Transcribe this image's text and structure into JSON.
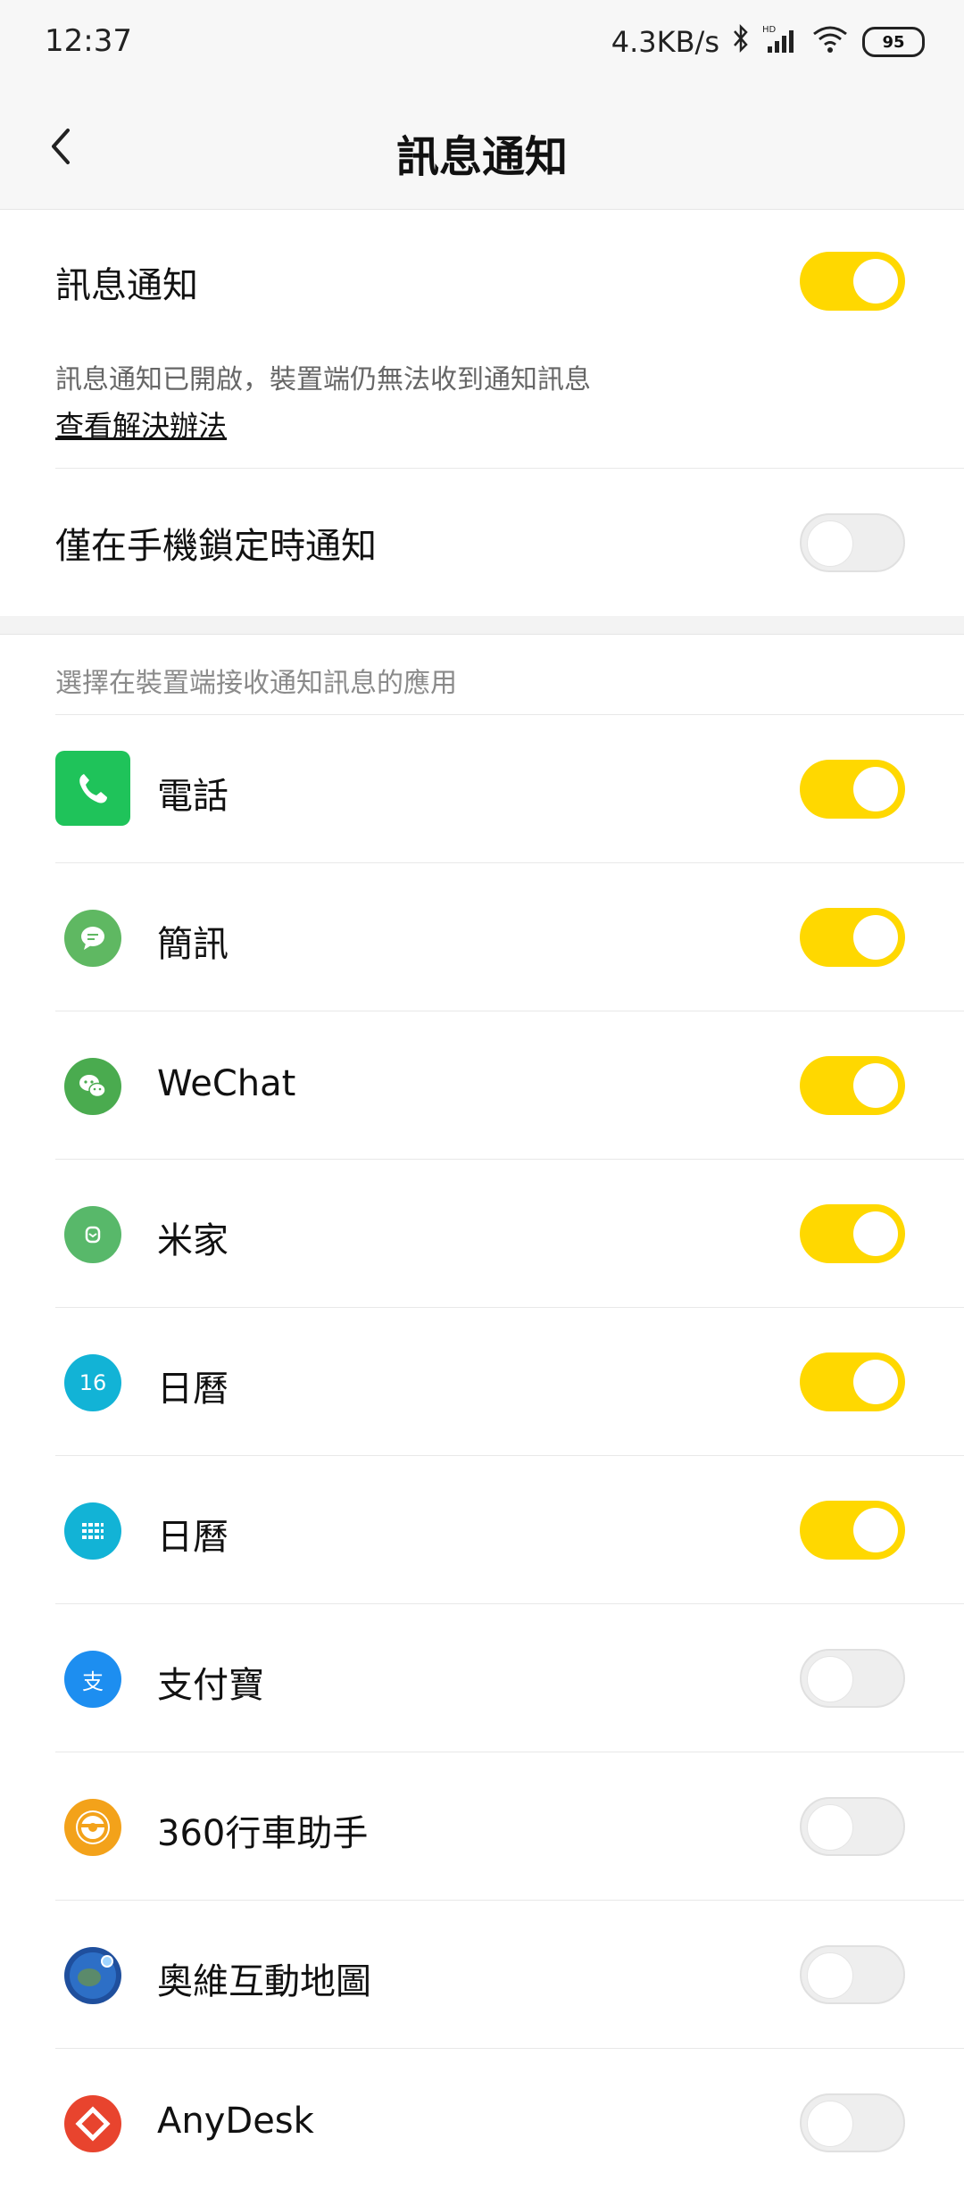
{
  "status_bar": {
    "time": "12:37",
    "net_speed": "4.3KB/s",
    "battery": "95",
    "icons": [
      "bluetooth-icon",
      "hd-signal-icon",
      "wifi-icon",
      "battery-icon"
    ]
  },
  "header": {
    "title": "訊息通知",
    "back_icon": "chevron-left-icon"
  },
  "settings": {
    "notify_label": "訊息通知",
    "notify_on": true,
    "notify_desc": "訊息通知已開啟，裝置端仍無法收到通知訊息",
    "solution_link": "查看解決辦法",
    "lock_only_label": "僅在手機鎖定時通知",
    "lock_only_on": false
  },
  "apps_section": {
    "header": "選擇在裝置端接收通知訊息的應用",
    "apps": [
      {
        "name": "電話",
        "icon": "phone-icon",
        "on": true
      },
      {
        "name": "簡訊",
        "icon": "message-icon",
        "on": true
      },
      {
        "name": "WeChat",
        "icon": "wechat-icon",
        "on": true
      },
      {
        "name": "米家",
        "icon": "mijia-icon",
        "on": true
      },
      {
        "name": "日曆",
        "icon": "calendar-icon",
        "icon_text": "16",
        "on": true
      },
      {
        "name": "日曆",
        "icon": "calendar-grid-icon",
        "on": true
      },
      {
        "name": "支付寶",
        "icon": "alipay-icon",
        "icon_text": "支",
        "on": false
      },
      {
        "name": "360行車助手",
        "icon": "steering-wheel-icon",
        "on": false
      },
      {
        "name": "奧維互動地圖",
        "icon": "globe-icon",
        "on": false
      },
      {
        "name": "AnyDesk",
        "icon": "anydesk-icon",
        "on": false
      }
    ]
  },
  "colors": {
    "toggle_on": "#ffd800",
    "toggle_off": "#eeeeee",
    "phone_green": "#1fc35a",
    "message_green": "#5fb862",
    "wechat_green": "#4aab4f",
    "mijia_green": "#58b86a",
    "calendar_cyan": "#12b3d6",
    "alipay_blue": "#1d8ef0",
    "car_orange": "#f3a21a",
    "map_blue": "#1f4f9d",
    "anydesk_red": "#e8442e"
  }
}
